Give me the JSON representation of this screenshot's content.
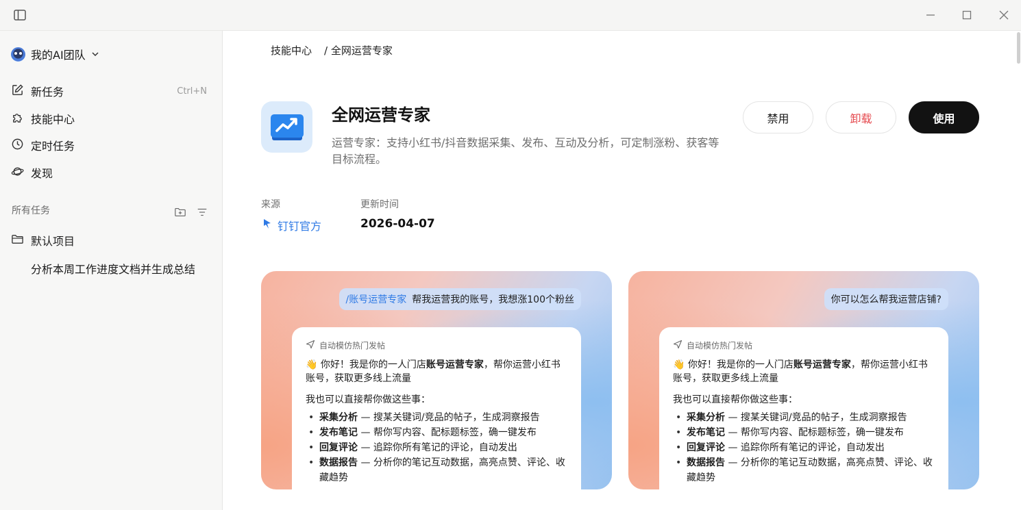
{
  "sidebar": {
    "team_name": "我的AI团队",
    "nav": [
      {
        "label": "新任务",
        "shortcut": "Ctrl+N"
      },
      {
        "label": "技能中心"
      },
      {
        "label": "定时任务"
      },
      {
        "label": "发现"
      }
    ],
    "section_label": "所有任务",
    "project_label": "默认项目",
    "task_label": "分析本周工作进度文档并生成总结"
  },
  "breadcrumb": {
    "root": "技能中心",
    "current": "/ 全网运营专家"
  },
  "skill": {
    "title": "全网运营专家",
    "description": "运营专家：支持小红书/抖音数据采集、发布、互动及分析，可定制涨粉、获客等目标流程。",
    "buttons": {
      "disable": "禁用",
      "uninstall": "卸载",
      "use": "使用"
    },
    "meta": {
      "source_label": "来源",
      "source_value": "钉钉官方",
      "updated_label": "更新时间",
      "updated_value": "2026-04-07"
    }
  },
  "previews": [
    {
      "bubble_cmd": "/账号运营专家",
      "bubble_text": "帮我运营我的账号，我想涨100个粉丝",
      "tag": "自动模仿热门发帖",
      "greet_pre": "👋 你好！我是你的一人门店",
      "greet_bold": "账号运营专家",
      "greet_post": "，帮你运营小红书账号，获取更多线上流量",
      "intro": "我也可以直接帮你做这些事：",
      "items": [
        {
          "bold": "采集分析",
          "text": " — 搜某关键词/竞品的帖子，生成洞察报告"
        },
        {
          "bold": "发布笔记",
          "text": " — 帮你写内容、配标题标签，确一键发布"
        },
        {
          "bold": "回复评论",
          "text": " — 追踪你所有笔记的评论，自动发出"
        },
        {
          "bold": "数据报告",
          "text": " — 分析你的笔记互动数据，高亮点赞、评论、收藏趋势"
        }
      ]
    },
    {
      "bubble_cmd": "",
      "bubble_text": "你可以怎么帮我运营店铺?",
      "tag": "自动模仿热门发帖",
      "greet_pre": "👋 你好！我是你的一人门店",
      "greet_bold": "账号运营专家",
      "greet_post": "，帮你运营小红书账号，获取更多线上流量",
      "intro": "我也可以直接帮你做这些事：",
      "items": [
        {
          "bold": "采集分析",
          "text": " — 搜某关键词/竞品的帖子，生成洞察报告"
        },
        {
          "bold": "发布笔记",
          "text": " — 帮你写内容、配标题标签，确一键发布"
        },
        {
          "bold": "回复评论",
          "text": " — 追踪你所有笔记的评论，自动发出"
        },
        {
          "bold": "数据报告",
          "text": " — 分析你的笔记互动数据，高亮点赞、评论、收藏趋势"
        }
      ]
    }
  ],
  "colors": {
    "accent": "#2f7ae5",
    "danger": "#e5484d",
    "primary_button": "#121212"
  }
}
